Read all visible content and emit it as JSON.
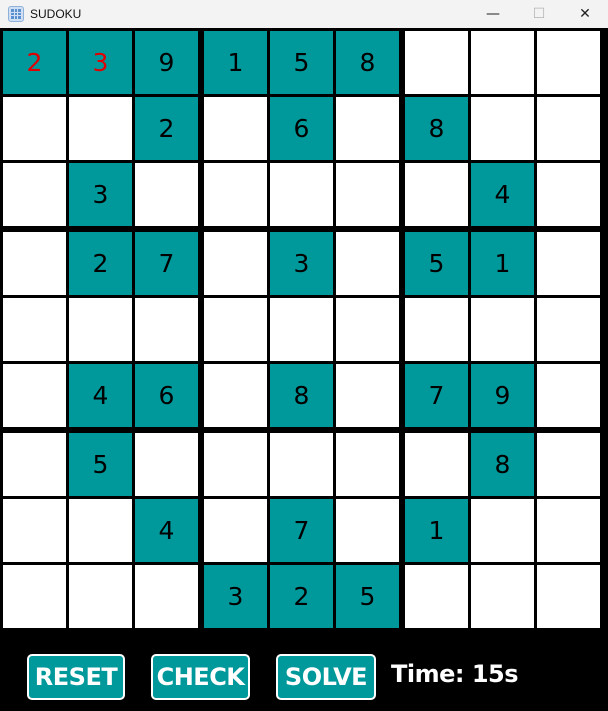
{
  "window": {
    "title": "SUDOKU",
    "minimize_glyph": "—",
    "maximize_glyph": "☐",
    "close_glyph": "✕"
  },
  "board": {
    "given_color": "#000000",
    "user_color": "#e00000",
    "filled_bg": "#00999b",
    "empty_bg": "#ffffff",
    "rows": [
      [
        "2",
        "3",
        "9",
        "1",
        "5",
        "8",
        "",
        "",
        ""
      ],
      [
        "",
        "",
        "2",
        "",
        "6",
        "",
        "8",
        "",
        ""
      ],
      [
        "",
        "3",
        "",
        "",
        "",
        "",
        "",
        "4",
        ""
      ],
      [
        "",
        "2",
        "7",
        "",
        "3",
        "",
        "5",
        "1",
        ""
      ],
      [
        "",
        "",
        "",
        "",
        "",
        "",
        "",
        "",
        ""
      ],
      [
        "",
        "4",
        "6",
        "",
        "8",
        "",
        "7",
        "9",
        ""
      ],
      [
        "",
        "5",
        "",
        "",
        "",
        "",
        "",
        "8",
        ""
      ],
      [
        "",
        "",
        "4",
        "",
        "7",
        "",
        "1",
        "",
        ""
      ],
      [
        "",
        "",
        "",
        "3",
        "2",
        "5",
        "",
        "",
        ""
      ]
    ],
    "user_entered": [
      [
        0,
        0
      ],
      [
        0,
        1
      ]
    ]
  },
  "controls": {
    "reset_label": "RESET",
    "check_label": "CHECK",
    "solve_label": "SOLVE",
    "timer_text": "Time: 15s"
  }
}
